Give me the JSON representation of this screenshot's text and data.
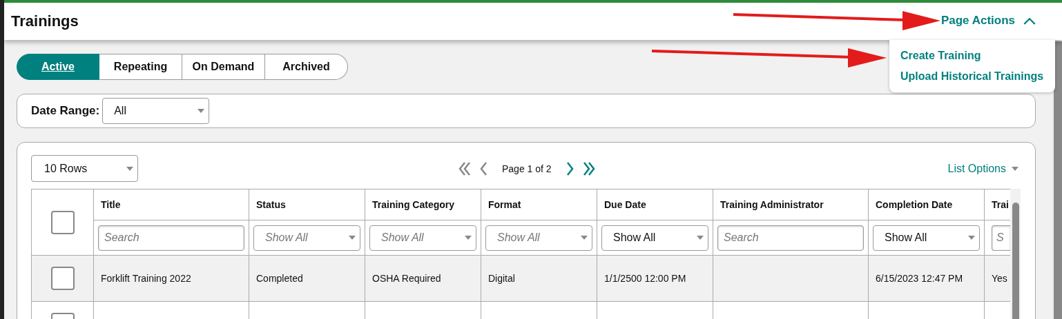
{
  "page": {
    "title": "Trainings"
  },
  "page_actions": {
    "label": "Page Actions",
    "expanded": true,
    "items": [
      "Create Training",
      "Upload Historical Trainings"
    ]
  },
  "tabs": [
    {
      "label": "Active",
      "selected": true
    },
    {
      "label": "Repeating",
      "selected": false
    },
    {
      "label": "On Demand",
      "selected": false
    },
    {
      "label": "Archived",
      "selected": false
    }
  ],
  "date_range": {
    "label": "Date Range:",
    "value": "All"
  },
  "table": {
    "select_all_checked": false,
    "rows_per_page": "10 Rows",
    "page_label": "Page 1 of 2",
    "list_options": "List Options",
    "columns": [
      {
        "label": "Title",
        "filter": {
          "kind": "search",
          "placeholder": "Search"
        }
      },
      {
        "label": "Status",
        "filter": {
          "kind": "select",
          "placeholder": "Show All"
        }
      },
      {
        "label": "Training Category",
        "filter": {
          "kind": "select",
          "placeholder": "Show All"
        }
      },
      {
        "label": "Format",
        "filter": {
          "kind": "select",
          "placeholder": "Show All"
        }
      },
      {
        "label": "Due Date",
        "filter": {
          "kind": "select",
          "value": "Show All"
        }
      },
      {
        "label": "Training Administrator",
        "filter": {
          "kind": "search",
          "placeholder": "Search"
        }
      },
      {
        "label": "Completion Date",
        "filter": {
          "kind": "select",
          "value": "Show All"
        }
      },
      {
        "label": "Trai",
        "filter": {
          "kind": "search",
          "placeholder": "S"
        }
      }
    ],
    "rows": [
      {
        "checked": false,
        "cells": [
          "Forklift Training 2022",
          "Completed",
          "OSHA Required",
          "Digital",
          "1/1/2500 12:00 PM",
          "",
          "6/15/2023 12:47 PM",
          "Yes"
        ]
      },
      {
        "checked": false,
        "cells": [
          "",
          "",
          "",
          "",
          "",
          "",
          "",
          ""
        ]
      }
    ]
  }
}
